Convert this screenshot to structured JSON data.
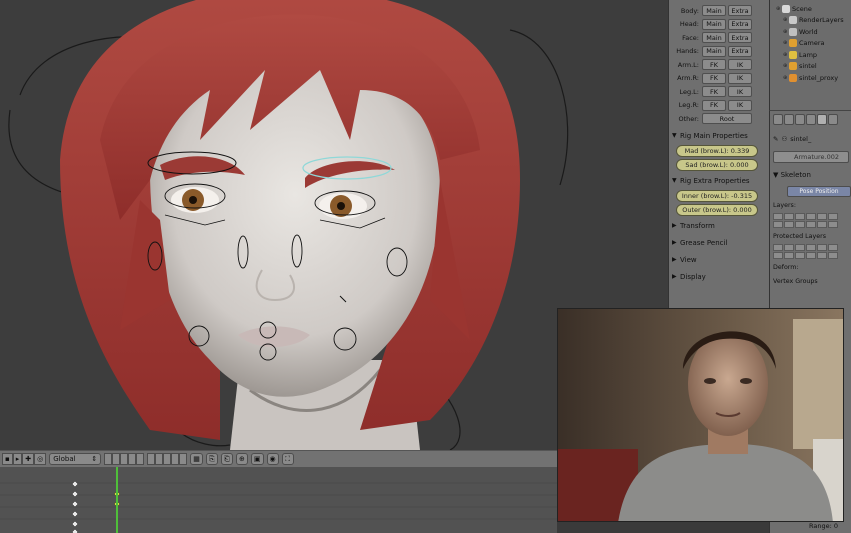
{
  "viewport": {
    "character": "sintel"
  },
  "toolbar": {
    "transform_orientation": "Global"
  },
  "tool_shelf": {
    "bone_layers": [
      {
        "label": "Body:",
        "buttons": [
          "Main",
          "Extra"
        ]
      },
      {
        "label": "Head:",
        "buttons": [
          "Main",
          "Extra"
        ]
      },
      {
        "label": "Face:",
        "buttons": [
          "Main",
          "Extra"
        ]
      },
      {
        "label": "Hands:",
        "buttons": [
          "Main",
          "Extra"
        ]
      },
      {
        "label": "Arm.L:",
        "buttons": [
          "FK",
          "IK"
        ]
      },
      {
        "label": "Arm.R:",
        "buttons": [
          "FK",
          "IK"
        ]
      },
      {
        "label": "Leg.L:",
        "buttons": [
          "FK",
          "IK"
        ]
      },
      {
        "label": "Leg.R:",
        "buttons": [
          "FK",
          "IK"
        ]
      },
      {
        "label": "Other:",
        "buttons": [
          "Root"
        ]
      }
    ],
    "rig_main": {
      "title": "Rig Main Properties",
      "sliders": [
        "Mad (brow.L): 0.339",
        "Sad (brow.L): 0.000"
      ]
    },
    "rig_extra": {
      "title": "Rig Extra Properties",
      "sliders": [
        "Inner (brow.L): -0.315",
        "Outer (brow.L): 0.000"
      ]
    },
    "collapsed_panels": [
      "Transform",
      "Grease Pencil",
      "View",
      "Display"
    ]
  },
  "outliner": {
    "items": [
      {
        "label": "Scene",
        "level": 0,
        "color": "#d8d8d8"
      },
      {
        "label": "RenderLayers",
        "level": 1,
        "color": "#c9c9c9"
      },
      {
        "label": "World",
        "level": 1,
        "color": "#c0c0c0"
      },
      {
        "label": "Camera",
        "level": 1,
        "color": "#e0a030"
      },
      {
        "label": "Lamp",
        "level": 1,
        "color": "#e0c040"
      },
      {
        "label": "sintel",
        "level": 1,
        "color": "#e0a030"
      },
      {
        "label": "sintel_proxy",
        "level": 1,
        "color": "#e09030"
      }
    ]
  },
  "properties_editor": {
    "object_name": "sintel_",
    "armature": "Armature.002",
    "skeleton_header": "Skeleton",
    "pose_position": "Pose Position",
    "layers_label": "Layers:",
    "protected_label": "Protected Layers",
    "deform_label": "Deform:",
    "vertex_groups": "Vertex Groups",
    "range": "Range: 0"
  },
  "colors": {
    "viewport_bg": "#3d3d3d",
    "panel_bg": "#6f6f6f",
    "slider": "#c8c78a",
    "active_curve": "#8fd8d8",
    "playhead": "#4fbf3a"
  }
}
